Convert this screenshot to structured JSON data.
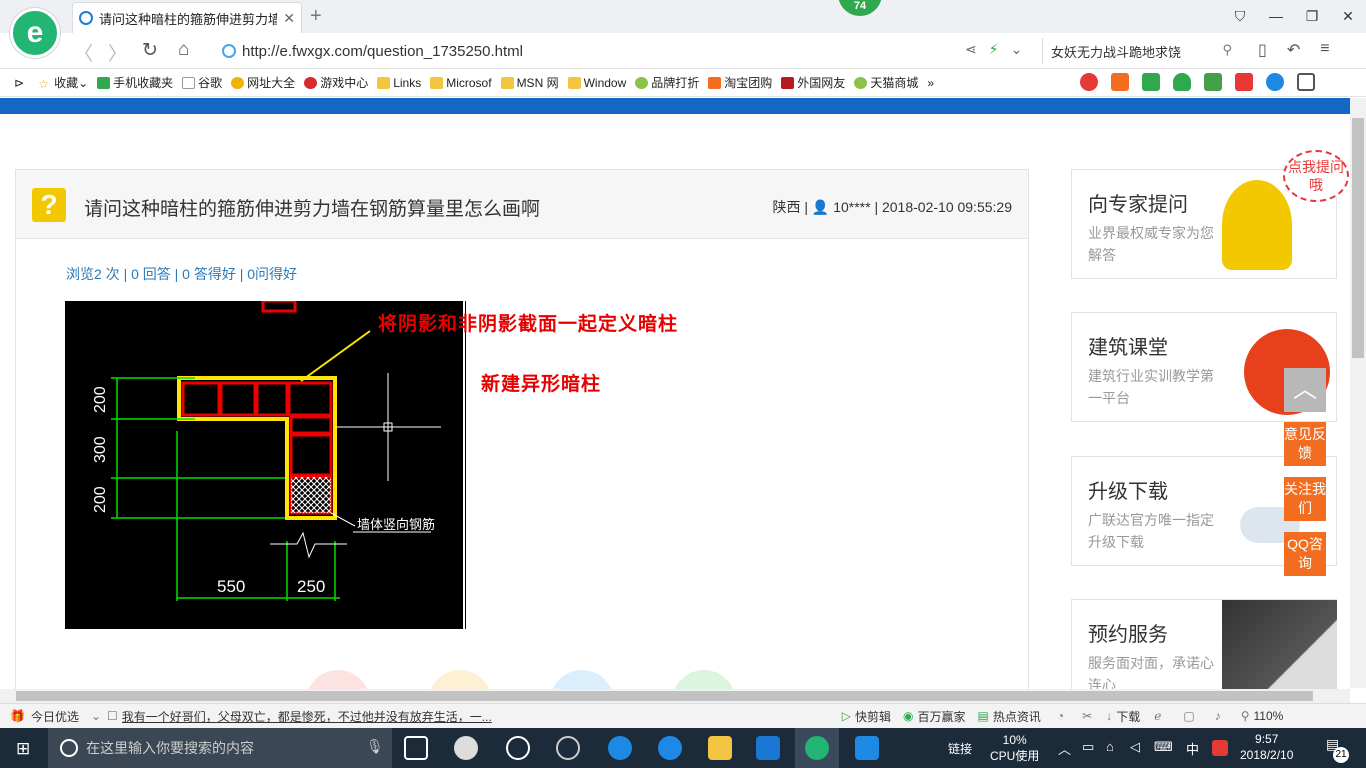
{
  "browser": {
    "tab_title": "请问这种暗柱的箍筋伸进剪力墙在",
    "tab_badge": "74",
    "url": "http://e.fwxgx.com/question_1735250.html",
    "search_text": "女妖无力战斗跪地求饶"
  },
  "bookmarks": [
    "收藏",
    "手机收藏夹",
    "谷歌",
    "网址大全",
    "游戏中心",
    "Links",
    "Microsof",
    "MSN 网",
    "Window",
    "品牌打折",
    "淘宝团购",
    "外国网友",
    "天猫商城"
  ],
  "question": {
    "icon": "?",
    "title": "请问这种暗柱的箍筋伸进剪力墙在钢筋算量里怎么画啊",
    "meta": "陕西 | 👤 10**** | 2018-02-10 09:55:29",
    "stats": "浏览2 次 | 0 回答 | 0 答得好 | 0问得好"
  },
  "cad": {
    "annot_red1": "将阴影和非阴影截面一起定义暗柱",
    "annot_red2": "新建异形暗柱",
    "label_wall": "墙体竖向钢筋",
    "dims_v": [
      "200",
      "300",
      "200"
    ],
    "dims_h": [
      "550",
      "250"
    ]
  },
  "sidebar": [
    {
      "title": "向专家提问",
      "desc": "业界最权威专家为您解答",
      "bubble": "点我提问哦"
    },
    {
      "title": "建筑课堂",
      "desc": "建筑行业实训教学第一平台"
    },
    {
      "title": "升级下载",
      "desc": "广联达官方唯一指定升级下载"
    },
    {
      "title": "预约服务",
      "desc": "服务面对面，承诺心连心"
    }
  ],
  "floating": {
    "feedback": "意见反馈",
    "follow": "关注我们",
    "qq": "QQ咨询"
  },
  "statusbar": {
    "today": "今日优选",
    "news": "我有一个好哥们，父母双亡，都是惨死，不过他并没有放弃生活，一...",
    "items": [
      "快剪辑",
      "百万赢家",
      "热点资讯",
      "下载"
    ],
    "zoom": "110%"
  },
  "taskbar": {
    "search_placeholder": "在这里输入你要搜索的内容",
    "link": "链接",
    "cpu": "10%",
    "cpu_label": "CPU使用",
    "ime": "中",
    "time": "9:57",
    "date": "2018/2/10",
    "notif": "21"
  }
}
